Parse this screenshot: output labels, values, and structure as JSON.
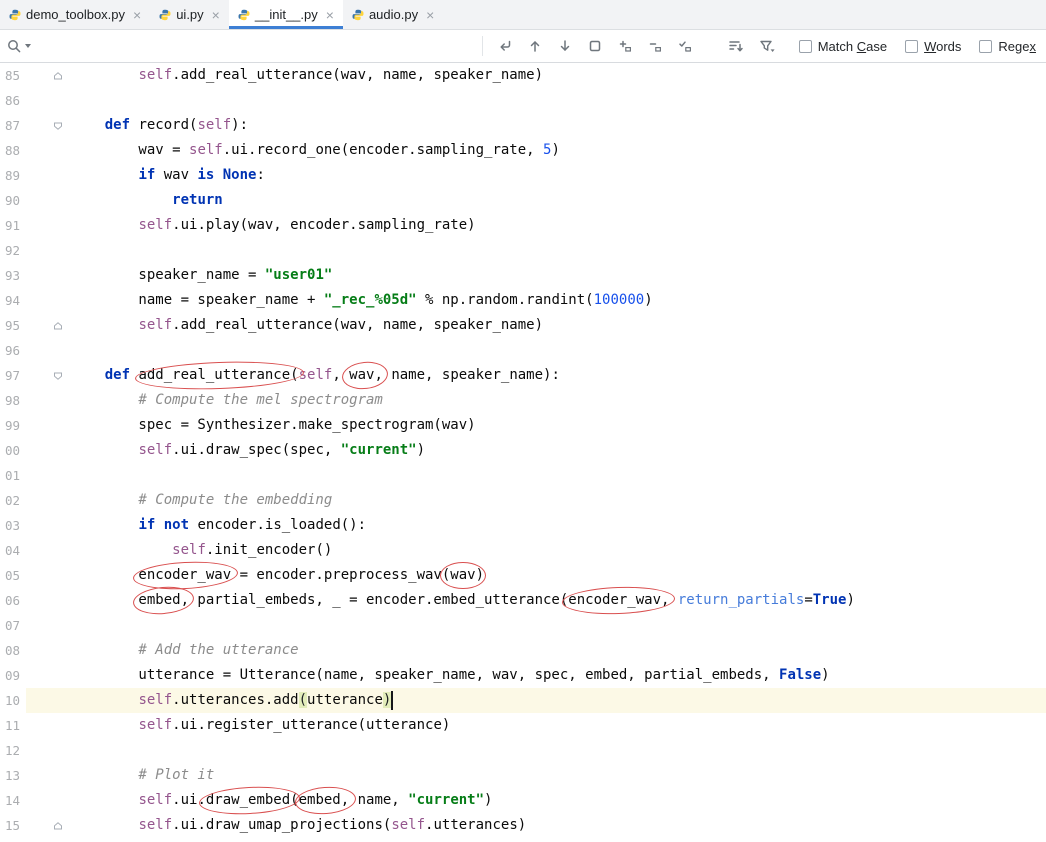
{
  "tab_bar": {
    "close_glyph": "×",
    "tabs": [
      {
        "label": "demo_toolbox.py",
        "active": false
      },
      {
        "label": "ui.py",
        "active": false
      },
      {
        "label": "__init__.py",
        "active": true
      },
      {
        "label": "audio.py",
        "active": false
      }
    ]
  },
  "find_bar": {
    "query": "",
    "options": [
      {
        "label": "Match Case",
        "mnemonic": "C",
        "checked": false
      },
      {
        "label": "Words",
        "mnemonic": "W",
        "checked": false
      },
      {
        "label": "Regex",
        "mnemonic": "x",
        "checked": false
      }
    ],
    "icons": [
      "search-icon",
      "search-history-caret-icon",
      "newline-icon",
      "previous-occurrence-icon",
      "next-occurrence-icon",
      "find-in-selection-icon",
      "add-occurrence-icon",
      "remove-occurrence-icon",
      "select-all-occurrences-icon",
      "filter-lines-icon",
      "filter-results-icon"
    ]
  },
  "colors": {
    "accent": "#3d7fd4",
    "keyword": "#0033b3",
    "string": "#067d17",
    "number": "#1750eb",
    "comment": "#8c8c8c",
    "self": "#94558d",
    "named_arg": "#467cda",
    "annotation": "#d94f4f",
    "line_highlight": "#fcf9e6",
    "brace_match": "#e3edbb"
  },
  "editor": {
    "cursor": {
      "row": 25,
      "col": 38
    },
    "lines": [
      {
        "num": "85",
        "fold": "end",
        "segs": [
          [
            "plain",
            "        "
          ],
          [
            "self",
            "self"
          ],
          [
            "plain",
            ".add_real_utterance(wav, name, speaker_name)"
          ]
        ]
      },
      {
        "num": "86",
        "segs": []
      },
      {
        "num": "87",
        "fold": "start",
        "segs": [
          [
            "plain",
            "    "
          ],
          [
            "kw",
            "def"
          ],
          [
            "plain",
            " record("
          ],
          [
            "self",
            "self"
          ],
          [
            "plain",
            "):"
          ]
        ]
      },
      {
        "num": "88",
        "segs": [
          [
            "plain",
            "        wav = "
          ],
          [
            "self",
            "self"
          ],
          [
            "plain",
            ".ui.record_one(encoder.sampling_rate, "
          ],
          [
            "num",
            "5"
          ],
          [
            "plain",
            ")"
          ]
        ]
      },
      {
        "num": "89",
        "segs": [
          [
            "plain",
            "        "
          ],
          [
            "kw",
            "if"
          ],
          [
            "plain",
            " wav "
          ],
          [
            "kw",
            "is"
          ],
          [
            "plain",
            " "
          ],
          [
            "kw",
            "None"
          ],
          [
            "plain",
            ":"
          ]
        ]
      },
      {
        "num": "90",
        "segs": [
          [
            "plain",
            "            "
          ],
          [
            "kw",
            "return"
          ]
        ]
      },
      {
        "num": "91",
        "segs": [
          [
            "plain",
            "        "
          ],
          [
            "self",
            "self"
          ],
          [
            "plain",
            ".ui.play(wav, encoder.sampling_rate)"
          ]
        ]
      },
      {
        "num": "92",
        "segs": []
      },
      {
        "num": "93",
        "segs": [
          [
            "plain",
            "        speaker_name = "
          ],
          [
            "str",
            "\"user01\""
          ]
        ]
      },
      {
        "num": "94",
        "segs": [
          [
            "plain",
            "        name = speaker_name + "
          ],
          [
            "str",
            "\"_rec_%05d\""
          ],
          [
            "plain",
            " % np.random.randint("
          ],
          [
            "num",
            "100000"
          ],
          [
            "plain",
            ")"
          ]
        ]
      },
      {
        "num": "95",
        "fold": "end",
        "segs": [
          [
            "plain",
            "        "
          ],
          [
            "self",
            "self"
          ],
          [
            "plain",
            ".add_real_utterance(wav, name, speaker_name)"
          ]
        ]
      },
      {
        "num": "96",
        "segs": []
      },
      {
        "num": "97",
        "fold": "start",
        "segs": [
          [
            "plain",
            "    "
          ],
          [
            "kw",
            "def"
          ],
          [
            "plain",
            " add_real_utterance("
          ],
          [
            "self",
            "self"
          ],
          [
            "plain",
            ", wav, name, speaker_name):"
          ]
        ]
      },
      {
        "num": "98",
        "segs": [
          [
            "com",
            "        # Compute the mel spectrogram"
          ]
        ]
      },
      {
        "num": "99",
        "segs": [
          [
            "plain",
            "        spec = Synthesizer.make_spectrogram(wav)"
          ]
        ]
      },
      {
        "num": "00",
        "segs": [
          [
            "plain",
            "        "
          ],
          [
            "self",
            "self"
          ],
          [
            "plain",
            ".ui.draw_spec(spec, "
          ],
          [
            "str",
            "\"current\""
          ],
          [
            "plain",
            ")"
          ]
        ]
      },
      {
        "num": "01",
        "segs": []
      },
      {
        "num": "02",
        "segs": [
          [
            "com",
            "        # Compute the embedding"
          ]
        ]
      },
      {
        "num": "03",
        "segs": [
          [
            "plain",
            "        "
          ],
          [
            "kw",
            "if"
          ],
          [
            "plain",
            " "
          ],
          [
            "kw",
            "not"
          ],
          [
            "plain",
            " encoder.is_loaded():"
          ]
        ]
      },
      {
        "num": "04",
        "segs": [
          [
            "plain",
            "            "
          ],
          [
            "self",
            "self"
          ],
          [
            "plain",
            ".init_encoder()"
          ]
        ]
      },
      {
        "num": "05",
        "segs": [
          [
            "plain",
            "        encoder_wav = encoder.preprocess_wav(wav)"
          ]
        ]
      },
      {
        "num": "06",
        "segs": [
          [
            "plain",
            "        embed, partial_embeds, _ = encoder.embed_utterance(encoder_wav, "
          ],
          [
            "arg",
            "return_partials"
          ],
          [
            "plain",
            "="
          ],
          [
            "kw",
            "True"
          ],
          [
            "plain",
            ")"
          ]
        ]
      },
      {
        "num": "07",
        "segs": []
      },
      {
        "num": "08",
        "segs": [
          [
            "com",
            "        # Add the utterance"
          ]
        ]
      },
      {
        "num": "09",
        "segs": [
          [
            "plain",
            "        utterance = Utterance(name, speaker_name, wav, spec, embed, partial_embeds, "
          ],
          [
            "kw",
            "False"
          ],
          [
            "plain",
            ")"
          ]
        ]
      },
      {
        "num": "10",
        "highlight": true,
        "segs": [
          [
            "plain",
            "        "
          ],
          [
            "self",
            "self"
          ],
          [
            "plain",
            ".utterances.add"
          ],
          [
            "brace",
            "("
          ],
          [
            "plain",
            "utterance"
          ],
          [
            "brace",
            ")"
          ]
        ]
      },
      {
        "num": "11",
        "segs": [
          [
            "plain",
            "        "
          ],
          [
            "self",
            "self"
          ],
          [
            "plain",
            ".ui.register_utterance(utterance)"
          ]
        ]
      },
      {
        "num": "12",
        "segs": []
      },
      {
        "num": "13",
        "segs": [
          [
            "com",
            "        # Plot it"
          ]
        ]
      },
      {
        "num": "14",
        "segs": [
          [
            "plain",
            "        "
          ],
          [
            "self",
            "self"
          ],
          [
            "plain",
            ".ui.draw_embed(embed, name, "
          ],
          [
            "str",
            "\"current\""
          ],
          [
            "plain",
            ")"
          ]
        ]
      },
      {
        "num": "15",
        "fold": "end",
        "segs": [
          [
            "plain",
            "        "
          ],
          [
            "self",
            "self"
          ],
          [
            "plain",
            ".ui.draw_umap_projections("
          ],
          [
            "self",
            "self"
          ],
          [
            "plain",
            ".utterances)"
          ]
        ]
      }
    ],
    "annotations": [
      {
        "row": 12,
        "target": "add_real_utterance",
        "col_start": 7.6,
        "col_end": 27.6,
        "tilt": -2
      },
      {
        "row": 12,
        "target": "wav-param",
        "col_start": 32.2,
        "col_end": 37.6,
        "tilt": -6
      },
      {
        "row": 20,
        "target": "encoder_wav",
        "col_start": 7.4,
        "col_end": 19.8,
        "tilt": -3
      },
      {
        "row": 20,
        "target": "wav-arg",
        "col_start": 43.8,
        "col_end": 49.2,
        "tilt": 0
      },
      {
        "row": 21,
        "target": "embed",
        "col_start": 7.4,
        "col_end": 14.6,
        "tilt": -5
      },
      {
        "row": 21,
        "target": "encoder_wav-arg",
        "col_start": 58.3,
        "col_end": 71.7,
        "tilt": -2
      },
      {
        "row": 29,
        "target": "draw_embed",
        "col_start": 15.2,
        "col_end": 27.2,
        "tilt": -3
      },
      {
        "row": 29,
        "target": "embed-arg",
        "col_start": 26.6,
        "col_end": 33.8,
        "tilt": -4
      }
    ]
  }
}
